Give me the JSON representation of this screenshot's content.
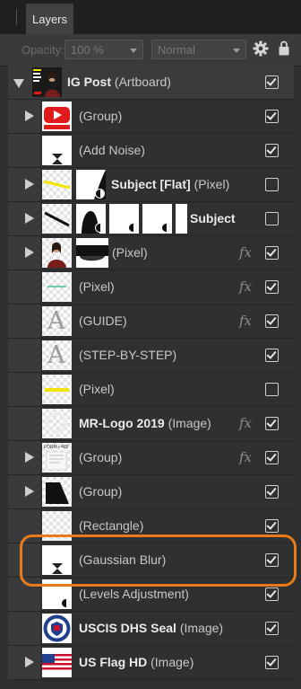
{
  "panel": {
    "tab": "Layers"
  },
  "toolbar": {
    "opacity_label": "Opacity:",
    "opacity_value": "100 %",
    "blend_mode": "Normal"
  },
  "layers": [
    {
      "name": "IG Post",
      "type": "(Artboard)",
      "checked": true,
      "expanded": true
    },
    {
      "name": "",
      "type": "(Group)",
      "checked": true,
      "thumb_text": "YOUTUBE"
    },
    {
      "name": "",
      "type": "(Add Noise)",
      "checked": true
    },
    {
      "name": "Subject [Flat]",
      "type": "(Pixel)",
      "checked": false
    },
    {
      "name": "Subject",
      "type": "",
      "checked": false
    },
    {
      "name": "",
      "type": "(Pixel)",
      "checked": true,
      "fx": "fx"
    },
    {
      "name": "",
      "type": "(Pixel)",
      "checked": true,
      "fx": "fx"
    },
    {
      "name": "",
      "type": "(GUIDE)",
      "checked": true,
      "fx": "fx",
      "thumb_text": "A"
    },
    {
      "name": "",
      "type": "(STEP-BY-STEP)",
      "checked": true,
      "thumb_text": "A"
    },
    {
      "name": "",
      "type": "(Pixel)",
      "checked": false
    },
    {
      "name": "MR-Logo 2019",
      "type": "(Image)",
      "checked": true,
      "fx": "fx"
    },
    {
      "name": "",
      "type": "(Group)",
      "checked": true,
      "fx": "fx",
      "thumb_text": "FORM I-485"
    },
    {
      "name": "",
      "type": "(Group)",
      "checked": true
    },
    {
      "name": "",
      "type": "(Rectangle)",
      "checked": true
    },
    {
      "name": "",
      "type": "(Gaussian Blur)",
      "checked": true
    },
    {
      "name": "",
      "type": "(Levels Adjustment)",
      "checked": true
    },
    {
      "name": "USCIS DHS Seal",
      "type": "(Image)",
      "checked": true
    },
    {
      "name": "US Flag HD",
      "type": "(Image)",
      "checked": true
    }
  ],
  "colors": {
    "highlight": "#e87b1c",
    "youtube_red": "#e01b1b",
    "flag_red": "#c8102e",
    "flag_blue": "#1f3f8f"
  }
}
